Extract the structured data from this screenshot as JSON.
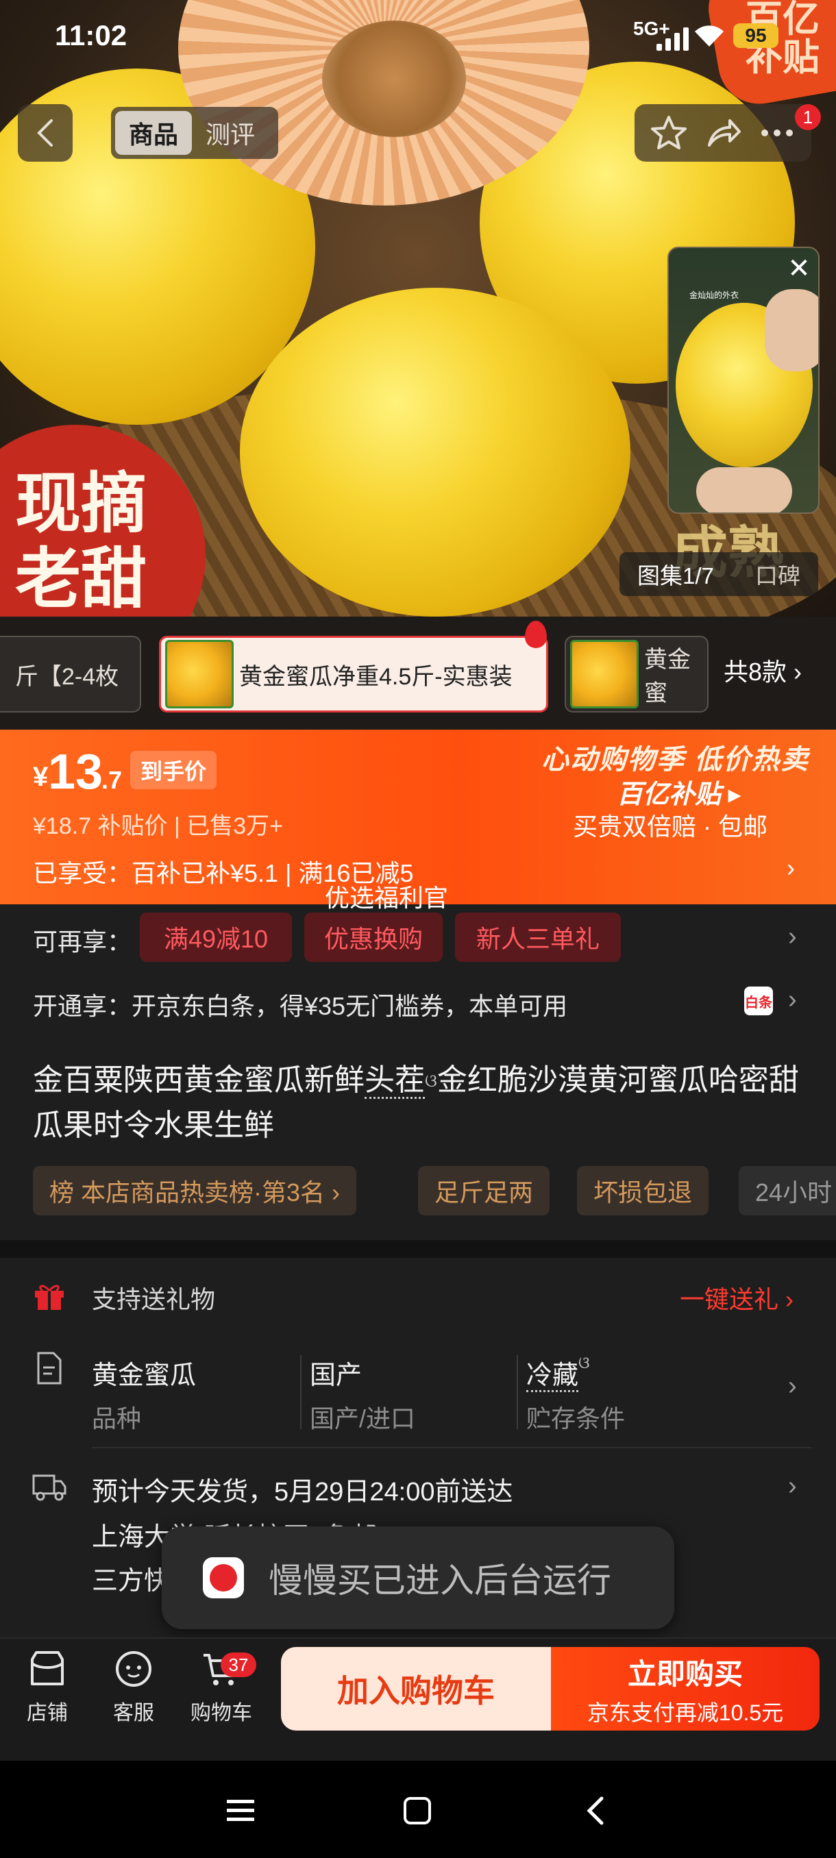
{
  "status_bar": {
    "time": "11:02",
    "network": "5G+",
    "battery": "95"
  },
  "corner_badge": {
    "text": "百亿补贴"
  },
  "nav": {
    "tabs": [
      {
        "label": "商品",
        "active": true
      },
      {
        "label": "测评",
        "active": false
      }
    ],
    "notification_count": "1"
  },
  "hero": {
    "badge_text": "现摘老甜",
    "background_text": "成熟",
    "video_caption": "金灿灿的外衣",
    "gallery_label": "图集1/7",
    "reputation_label": "口碑"
  },
  "variants": {
    "items": [
      {
        "label": "斤【2-4枚",
        "selected": false
      },
      {
        "label": "黄金蜜瓜净重4.5斤-实惠装",
        "selected": true
      },
      {
        "label": "黄金蜜",
        "selected": false
      }
    ],
    "total_label": "共8款"
  },
  "price": {
    "currency": "¥",
    "integer": "13",
    "decimal": ".7",
    "tag": "到手价",
    "original_line": "¥18.7  补贴价 | 已售3万+",
    "enjoyed_line": "已享受：百补已补¥5.1 | 满16已减5",
    "welfare": "优选福利官",
    "promo_title": "心动购物季 低价热卖",
    "promo_brand": "百亿补贴 ▸",
    "promo_sub": "买贵双倍赔 · 包邮"
  },
  "more_offers": {
    "label": "可再享：",
    "chips": [
      "满49减10",
      "优惠换购",
      "新人三单礼"
    ]
  },
  "open_offer": {
    "label": "开通享：开京东白条，得¥35无门槛券，本单可用",
    "icon_text": "白条"
  },
  "product": {
    "title_part1": "金百粟陕西黄金蜜瓜新鲜",
    "title_link": "头茬",
    "title_part2": "金红脆沙漠黄河蜜瓜哈密甜瓜果时令水果生鲜",
    "tags": [
      "榜 本店商品热卖榜·第3名 ›",
      "足斤足两",
      "坏损包退",
      "24小时"
    ]
  },
  "gift": {
    "label": "支持送礼物",
    "action": "一键送礼"
  },
  "attributes": [
    {
      "value": "黄金蜜瓜",
      "key": "品种"
    },
    {
      "value": "国产",
      "key": "国产/进口"
    },
    {
      "value": "冷藏",
      "key": "贮存条件"
    }
  ],
  "shipping": {
    "line1": "预计今天发货，5月29日24:00前送达",
    "line2": "上海大学(延长校区)  免邮",
    "line3": "三方快递"
  },
  "toast": {
    "text": "慢慢买已进入后台运行"
  },
  "bottom_bar": {
    "store": "店铺",
    "service": "客服",
    "cart": "购物车",
    "cart_count": "37",
    "add_to_cart": "加入购物车",
    "buy_now": "立即购买",
    "buy_now_sub": "京东支付再减10.5元"
  },
  "colors": {
    "accent": "#ff4f0e",
    "red": "#e5242b",
    "background": "#1e1e1e"
  }
}
